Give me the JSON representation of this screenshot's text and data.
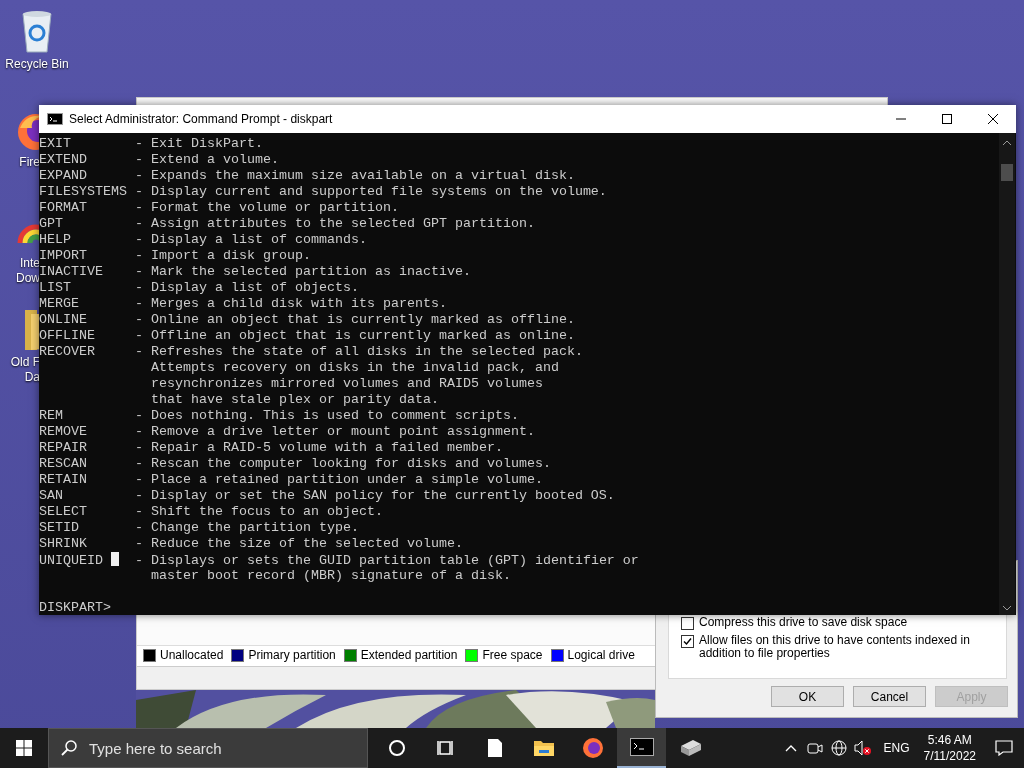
{
  "desktop": {
    "icons": [
      {
        "kind": "recycle_bin",
        "label_lines": [
          "Recycle Bin"
        ]
      },
      {
        "kind": "firefox",
        "label_lines": [
          "Fire"
        ]
      },
      {
        "kind": "download_manager",
        "label_lines": [
          "Inte",
          "Dow"
        ]
      },
      {
        "kind": "folder",
        "label_lines": [
          "Old F",
          "Da"
        ]
      }
    ]
  },
  "console": {
    "title": "Select Administrator: Command Prompt - diskpart",
    "lines": [
      {
        "kind": "text",
        "text": "EXIT        - Exit DiskPart."
      },
      {
        "kind": "text",
        "text": "EXTEND      - Extend a volume."
      },
      {
        "kind": "text",
        "text": "EXPAND      - Expands the maximum size available on a virtual disk."
      },
      {
        "kind": "text",
        "text": "FILESYSTEMS - Display current and supported file systems on the volume."
      },
      {
        "kind": "text",
        "text": "FORMAT      - Format the volume or partition."
      },
      {
        "kind": "text",
        "text": "GPT         - Assign attributes to the selected GPT partition."
      },
      {
        "kind": "text",
        "text": "HELP        - Display a list of commands."
      },
      {
        "kind": "text",
        "text": "IMPORT      - Import a disk group."
      },
      {
        "kind": "text",
        "text": "INACTIVE    - Mark the selected partition as inactive."
      },
      {
        "kind": "text",
        "text": "LIST        - Display a list of objects."
      },
      {
        "kind": "text",
        "text": "MERGE       - Merges a child disk with its parents."
      },
      {
        "kind": "text",
        "text": "ONLINE      - Online an object that is currently marked as offline."
      },
      {
        "kind": "text",
        "text": "OFFLINE     - Offline an object that is currently marked as online."
      },
      {
        "kind": "text",
        "text": "RECOVER     - Refreshes the state of all disks in the selected pack."
      },
      {
        "kind": "text",
        "text": "              Attempts recovery on disks in the invalid pack, and"
      },
      {
        "kind": "text",
        "text": "              resynchronizes mirrored volumes and RAID5 volumes"
      },
      {
        "kind": "text",
        "text": "              that have stale plex or parity data."
      },
      {
        "kind": "text",
        "text": "REM         - Does nothing. This is used to comment scripts."
      },
      {
        "kind": "text",
        "text": "REMOVE      - Remove a drive letter or mount point assignment."
      },
      {
        "kind": "text",
        "text": "REPAIR      - Repair a RAID-5 volume with a failed member."
      },
      {
        "kind": "text",
        "text": "RESCAN      - Rescan the computer looking for disks and volumes."
      },
      {
        "kind": "text",
        "text": "RETAIN      - Place a retained partition under a simple volume."
      },
      {
        "kind": "text",
        "text": "SAN         - Display or set the SAN policy for the currently booted OS."
      },
      {
        "kind": "text",
        "text": "SELECT      - Shift the focus to an object."
      },
      {
        "kind": "text",
        "text": "SETID       - Change the partition type."
      },
      {
        "kind": "text",
        "text": "SHRINK      - Reduce the size of the selected volume."
      },
      {
        "kind": "cursor_line",
        "before": "UNIQUEID ",
        "after": "  - Displays or sets the GUID partition table (GPT) identifier or"
      },
      {
        "kind": "text",
        "text": "              master boot record (MBR) signature of a disk."
      },
      {
        "kind": "prompt",
        "text": "DISKPART>"
      }
    ]
  },
  "disk_management": {
    "legend": [
      {
        "label": "Unallocated",
        "color": "#000000"
      },
      {
        "label": "Primary partition",
        "color": "#000080"
      },
      {
        "label": "Extended partition",
        "color": "#008000"
      },
      {
        "label": "Free space",
        "color": "#00ff00"
      },
      {
        "label": "Logical drive",
        "color": "#0000ff"
      }
    ]
  },
  "properties_dialog": {
    "options": [
      {
        "label": "Compress this drive to save disk space",
        "checked": false
      },
      {
        "label": "Allow files on this drive to have contents indexed in addition to file properties",
        "checked": true
      }
    ],
    "buttons": [
      {
        "label": "OK",
        "disabled": false
      },
      {
        "label": "Cancel",
        "disabled": false
      },
      {
        "label": "Apply",
        "disabled": true
      }
    ]
  },
  "taskbar": {
    "search": {
      "placeholder": "Type here to search"
    },
    "apps": [
      {
        "kind": "cortana",
        "active": false
      },
      {
        "kind": "task_view",
        "active": false
      },
      {
        "kind": "document",
        "active": false
      },
      {
        "kind": "folder",
        "active": false
      },
      {
        "kind": "firefox",
        "active": false
      },
      {
        "kind": "terminal",
        "active": true
      },
      {
        "kind": "drive",
        "active": false
      }
    ],
    "tray": {
      "language": "ENG",
      "time": "5:46 AM",
      "date": "7/11/2022"
    }
  }
}
